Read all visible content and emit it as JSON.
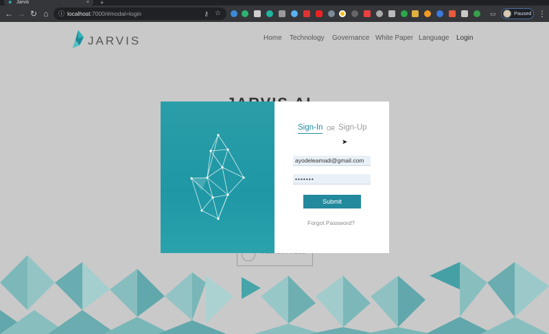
{
  "browser": {
    "tab_title": "Jarvis",
    "tab_close": "×",
    "new_tab": "+",
    "url_host": "localhost",
    "url_path": ":7000/#modal=login",
    "profile_label": "Paused"
  },
  "site": {
    "logo_text": "JARVIS",
    "nav": [
      "Home",
      "Technology",
      "Governance",
      "White Paper",
      "Language",
      "Login"
    ],
    "hero_title": "JARVIS AI",
    "video_label": "VIEW OUR VIDEO"
  },
  "modal": {
    "signin_tab": "Sign-In",
    "or_label": "OR",
    "signup_tab": "Sign-Up",
    "email_value": "ayodeleamadi@gmail.com",
    "password_value": "•••••••",
    "submit_label": "Submit",
    "forgot_label": "Forgot Password?"
  },
  "colors": {
    "brand": "#2a9ea8",
    "button": "#23899c",
    "backdrop": "#c9c9c9"
  }
}
